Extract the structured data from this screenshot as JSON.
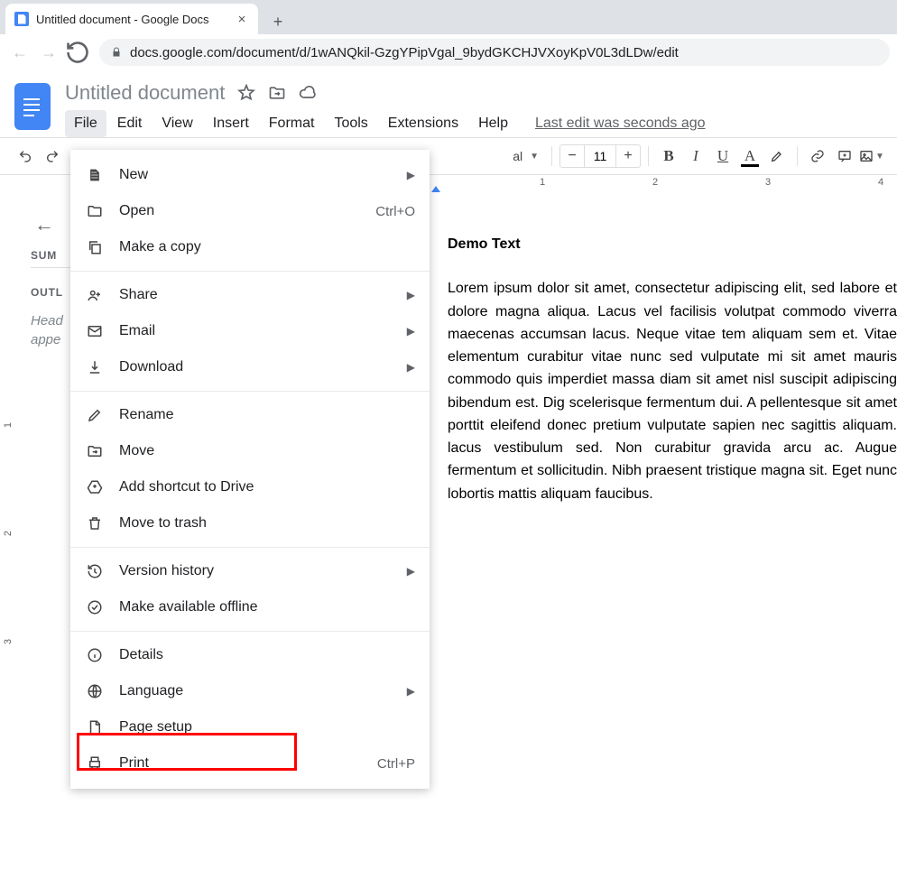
{
  "browser": {
    "tab_title": "Untitled document - Google Docs",
    "url": "docs.google.com/document/d/1wANQkil-GzgYPipVgal_9bydGKCHJVXoyKpV0L3dLDw/edit"
  },
  "header": {
    "doc_title": "Untitled document",
    "menus": [
      "File",
      "Edit",
      "View",
      "Insert",
      "Format",
      "Tools",
      "Extensions",
      "Help"
    ],
    "last_edit": "Last edit was seconds ago"
  },
  "toolbar": {
    "style_dropdown": "al",
    "font_size": "11"
  },
  "ruler": {
    "marks": [
      "1",
      "2",
      "3",
      "4"
    ]
  },
  "vruler": {
    "marks": [
      "1",
      "2",
      "3"
    ]
  },
  "outline": {
    "summary_label": "SUM",
    "outline_label": "OUTL",
    "hint_line1": "Head",
    "hint_line2": "appe"
  },
  "document": {
    "heading": "Demo Text",
    "body": "Lorem ipsum dolor sit amet, consectetur adipiscing elit, sed labore et dolore magna aliqua. Lacus vel facilisis volutpat commodo viverra maecenas accumsan lacus. Neque vitae tem aliquam sem et. Vitae elementum curabitur vitae nunc sed vulputate mi sit amet mauris commodo quis imperdiet massa diam sit amet nisl suscipit adipiscing bibendum est. Dig scelerisque fermentum dui. A pellentesque sit amet porttit eleifend donec pretium vulputate sapien nec sagittis aliquam. lacus vestibulum sed. Non curabitur gravida arcu ac. Augue fermentum et sollicitudin. Nibh praesent tristique magna sit. Eget nunc lobortis mattis aliquam faucibus."
  },
  "file_menu": {
    "new": "New",
    "open": "Open",
    "open_sc": "Ctrl+O",
    "copy": "Make a copy",
    "share": "Share",
    "email": "Email",
    "download": "Download",
    "rename": "Rename",
    "move": "Move",
    "shortcut": "Add shortcut to Drive",
    "trash": "Move to trash",
    "version": "Version history",
    "offline": "Make available offline",
    "details": "Details",
    "language": "Language",
    "pagesetup": "Page setup",
    "print": "Print",
    "print_sc": "Ctrl+P"
  }
}
